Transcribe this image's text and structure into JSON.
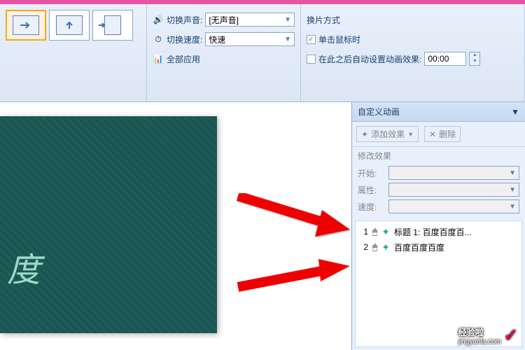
{
  "ribbon": {
    "sound_label": "切换声音:",
    "sound_value": "[无声音]",
    "speed_label": "切换速度:",
    "speed_value": "快速",
    "apply_all": "全部应用",
    "advance_title": "换片方式",
    "on_click": "单击鼠标时",
    "auto_after": "在此之后自动设置动画效果:",
    "time": "00:00"
  },
  "slide": {
    "text": "度"
  },
  "taskpane": {
    "title": "自定义动画",
    "add_effect": "添加效果",
    "remove": "删除",
    "modify_label": "修改效果",
    "start_label": "开始:",
    "property_label": "属性:",
    "speed_label": "速度:",
    "items": [
      {
        "num": "1",
        "text": "标题 1: 百度百度百..."
      },
      {
        "num": "2",
        "text": "百度百度百度"
      }
    ]
  },
  "watermark": {
    "main": "经验啦",
    "sub": "jingyanla.com"
  }
}
